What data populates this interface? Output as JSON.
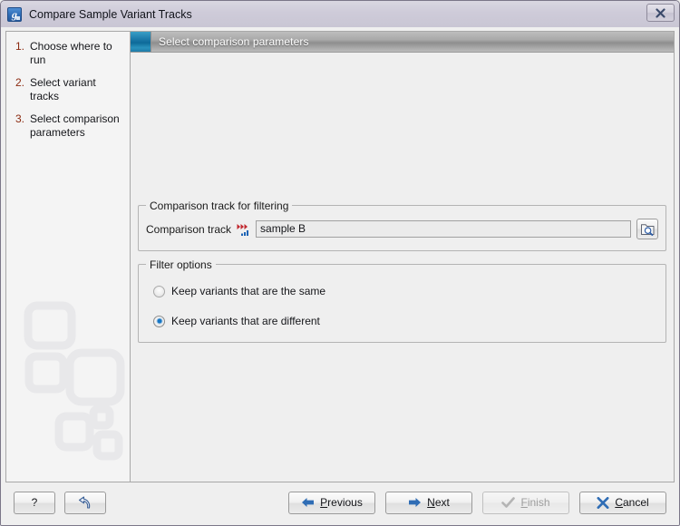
{
  "window": {
    "title": "Compare Sample Variant Tracks",
    "app_icon": "clc-workbench-icon",
    "close_label": "X"
  },
  "sidebar": {
    "steps": [
      {
        "num": "1.",
        "label": "Choose where to run"
      },
      {
        "num": "2.",
        "label": "Select variant tracks"
      },
      {
        "num": "3.",
        "label": "Select comparison parameters"
      }
    ]
  },
  "content": {
    "header_title": "Select comparison parameters",
    "comparison_group": {
      "legend": "Comparison track for filtering",
      "field_label": "Comparison track",
      "field_value": "sample B",
      "field_placeholder": "",
      "browse_icon": "folder-search-icon",
      "track_icon": "variant-track-icon"
    },
    "filter_group": {
      "legend": "Filter options",
      "options": [
        {
          "label": "Keep variants that are the same",
          "selected": false
        },
        {
          "label": "Keep variants that are different",
          "selected": true
        }
      ]
    }
  },
  "footer": {
    "help_label": "?",
    "reset_label": "",
    "previous": {
      "label_pre": "",
      "label_key": "P",
      "label_post": "revious"
    },
    "next": {
      "label_pre": "",
      "label_key": "N",
      "label_post": "ext"
    },
    "finish": {
      "label_pre": "",
      "label_key": "F",
      "label_post": "inish",
      "disabled": true
    },
    "cancel": {
      "label_pre": "",
      "label_key": "C",
      "label_post": "ancel"
    }
  },
  "colors": {
    "titlebar": "#cecbd9",
    "accent_blue": "#1676c4",
    "step_number": "#8b2a10",
    "header_icon": "#1f7fae",
    "panel_bg": "#efefef"
  }
}
